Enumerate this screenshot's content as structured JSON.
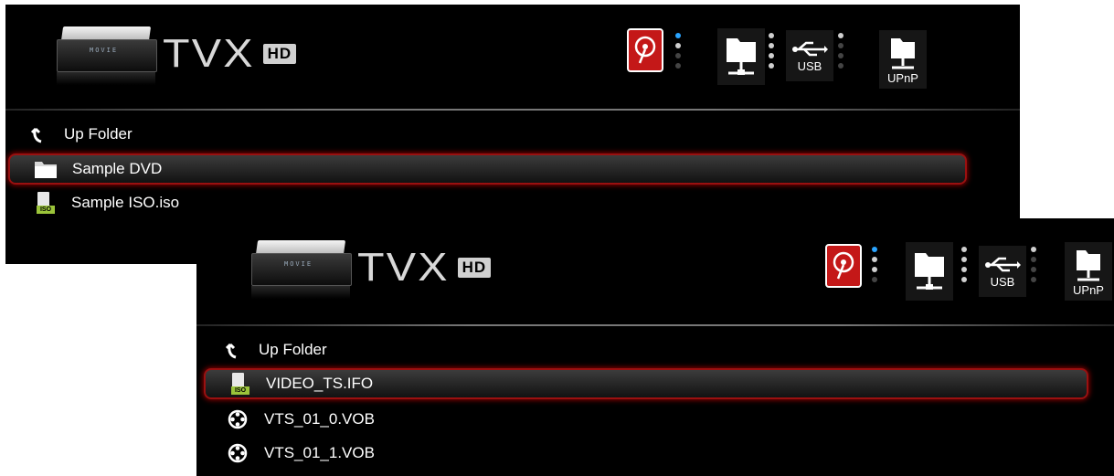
{
  "brand": {
    "name": "TVX",
    "badge": "HD",
    "device_screen": "MOVIE"
  },
  "sources": {
    "usb_label": "USB",
    "upnp_label": "UPnP"
  },
  "back_panel": {
    "rows": [
      {
        "label": "Up Folder",
        "icon": "up-arrow-icon"
      },
      {
        "label": "Sample DVD",
        "icon": "folder-icon",
        "selected": true
      },
      {
        "label": "Sample ISO.iso",
        "icon": "iso-file-icon"
      }
    ]
  },
  "front_panel": {
    "rows": [
      {
        "label": "Up Folder",
        "icon": "up-arrow-icon"
      },
      {
        "label": "VIDEO_TS.IFO",
        "icon": "iso-file-icon",
        "selected": true
      },
      {
        "label": "VTS_01_0.VOB",
        "icon": "film-reel-icon"
      },
      {
        "label": "VTS_01_1.VOB",
        "icon": "film-reel-icon"
      }
    ]
  },
  "colors": {
    "selection_border": "#9a1010",
    "hdd_red": "#c41818",
    "active_dot": "#2aa4ff",
    "iso_green": "#9bc43a"
  }
}
